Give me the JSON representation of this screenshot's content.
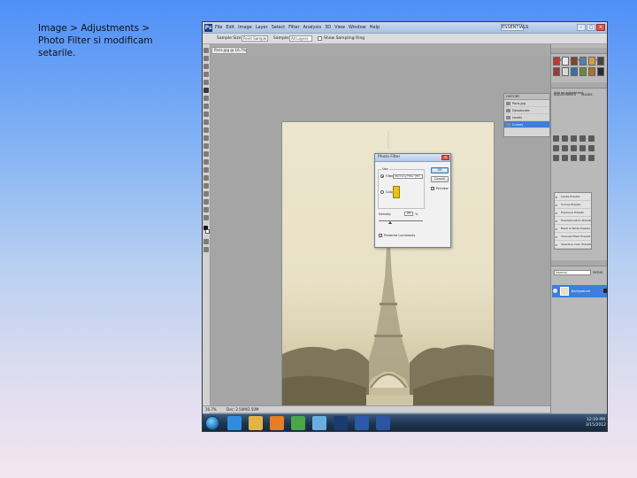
{
  "caption": {
    "line1": "Image > Adjustments >",
    "line2": "Photo Filter si modificam",
    "line3": "setarile."
  },
  "photoshop": {
    "menu": [
      "File",
      "Edit",
      "Image",
      "Layer",
      "Select",
      "Filter",
      "Analysis",
      "3D",
      "View",
      "Window",
      "Help"
    ],
    "workspace_button": "ESSENTIALS",
    "window_buttons": {
      "minimize": "–",
      "maximize": "□",
      "close": "✕"
    },
    "options_bar": {
      "sample_size_label": "Sample Size:",
      "sample_size_value": "Point Sample",
      "sample_label": "Sample:",
      "sample_value": "All Layers",
      "show_ring_label": "Show Sampling Ring"
    },
    "document_tab": "Paris.jpg @ 16.7% (RGB/8)",
    "status_bar": {
      "zoom": "16.7%",
      "doc_size": "Doc: 2.50M/2.50M"
    },
    "history": {
      "title": "HISTORY",
      "items": [
        "Paris.jpg",
        "Desaturate",
        "Levels",
        "Curves"
      ],
      "selected_index": 3
    },
    "panels": {
      "swatches_tabs": [
        "COLOR",
        "SWATCHES",
        "STYLES"
      ],
      "adjustments_tabs": [
        "ADJUSTMENTS",
        "MASKS"
      ],
      "add_adjustment_label": "Add an adjustment",
      "presets": [
        "Levels Presets",
        "Curves Presets",
        "Exposure Presets",
        "Hue/Saturation Presets",
        "Black & White Presets",
        "Channel Mixer Presets",
        "Selective Color Presets"
      ],
      "layers_tabs": [
        "LAYERS",
        "CHANNELS",
        "PATHS"
      ],
      "blend_mode": "Normal",
      "layer_name": "Background",
      "swatch_colors": [
        "#c0392b",
        "#e8e8e8",
        "#7a4a2a",
        "#5a7fa8",
        "#d0a040",
        "#444444",
        "#9b3a3a",
        "#d8d8d8",
        "#3a6ea8",
        "#6a8a3a",
        "#b07030",
        "#2a2a2a"
      ]
    },
    "photo_filter_dialog": {
      "title": "Photo Filter",
      "use_label": "Use",
      "filter_label": "Filter:",
      "filter_value": "Warming Filter (85)",
      "color_label": "Color:",
      "swatch_color": "#e8c31b",
      "density_label": "Density:",
      "density_value": "25",
      "density_unit": "%",
      "preserve_label": "Preserve Luminosity",
      "buttons": {
        "ok": "OK",
        "cancel": "Cancel",
        "preview": "Preview"
      }
    },
    "taskbar": {
      "time": "12:19 PM",
      "date": "3/15/2012",
      "apps": [
        {
          "name": "internet-explorer",
          "color": "#2f8ce0"
        },
        {
          "name": "windows-explorer",
          "color": "#e3b34a"
        },
        {
          "name": "media-player",
          "color": "#e87d22"
        },
        {
          "name": "chrome",
          "color": "#4aa64a"
        },
        {
          "name": "messenger",
          "color": "#6aaee0"
        },
        {
          "name": "photoshop",
          "color": "#1b3a70"
        },
        {
          "name": "word",
          "color": "#2b5aaa"
        },
        {
          "name": "bridge",
          "color": "#2a55a0"
        }
      ]
    }
  }
}
